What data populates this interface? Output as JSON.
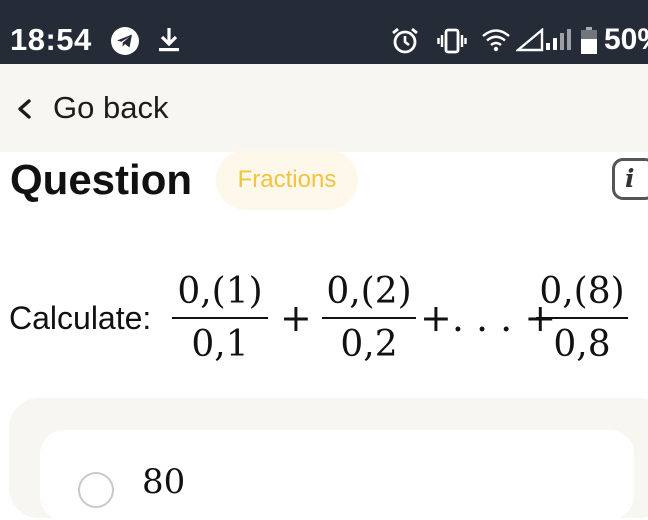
{
  "status_bar": {
    "time": "18:54",
    "battery_text": "50%",
    "icons": [
      "telegram-icon",
      "download-icon",
      "alarm-icon",
      "vibrate-icon",
      "wifi-icon",
      "signal-icon",
      "battery-icon"
    ]
  },
  "header": {
    "back_label": "Go back"
  },
  "question": {
    "title": "Question",
    "tag": "Fractions",
    "info_glyph": "i"
  },
  "expression": {
    "label": "Calculate:",
    "fraction_1": {
      "numerator": "0,(1)",
      "denominator": "0,1"
    },
    "plus": "+",
    "fraction_2": {
      "numerator": "0,(2)",
      "denominator": "0,2"
    },
    "ellipsis_part": "+. . . +",
    "fraction_3": {
      "numerator": "0,(8)",
      "denominator": "0,8"
    }
  },
  "options": [
    {
      "label": "80"
    }
  ],
  "colors": {
    "status_bar_bg": "#262c37",
    "header_bg": "#f7f6f1",
    "tag_bg": "#fdf8ea",
    "tag_text": "#f2c240"
  }
}
